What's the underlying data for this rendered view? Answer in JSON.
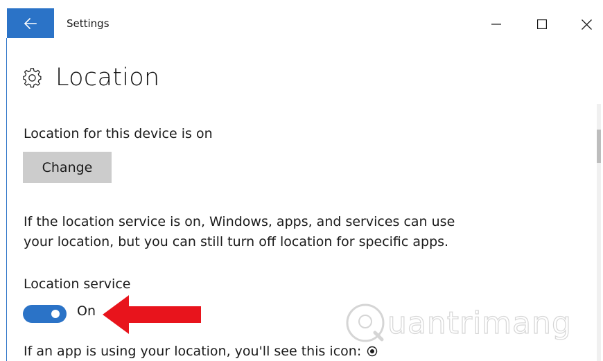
{
  "window": {
    "title": "Settings",
    "accent_color": "#2b73c7"
  },
  "icons": {
    "back": "back-arrow-icon",
    "minimize": "minimize-icon",
    "maximize": "maximize-icon",
    "close": "close-icon",
    "gear": "gear-icon",
    "location": "location-indicator-icon"
  },
  "page": {
    "title": "Location",
    "device_status": "Location for this device is on",
    "change_button": "Change",
    "description_line1": "If the location service is on, Windows, apps, and services can use",
    "description_line2": "your location, but you can still turn off location for specific apps.",
    "service_label": "Location service",
    "service_state": "On",
    "service_enabled": true,
    "icon_note": "If an app is using your location, you'll see this icon:"
  },
  "watermark": {
    "text": "uantrimang"
  }
}
